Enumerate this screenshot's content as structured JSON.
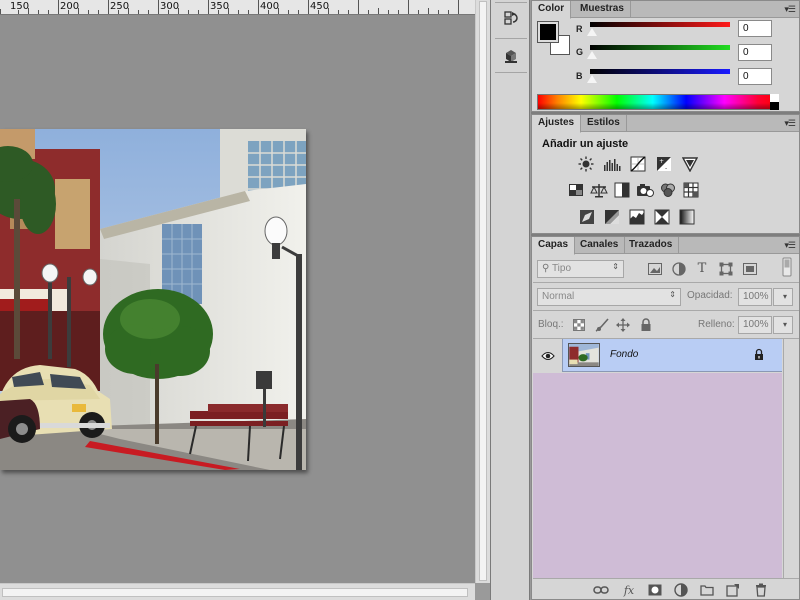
{
  "ruler": {
    "labels": [
      "150",
      "200",
      "250",
      "300",
      "350",
      "400",
      "450"
    ]
  },
  "color_panel": {
    "tabs": [
      "Color",
      "Muestras"
    ],
    "channels": [
      {
        "label": "R",
        "value": "0",
        "gradient_end": "#ff1a1a"
      },
      {
        "label": "G",
        "value": "0",
        "gradient_end": "#22dd22"
      },
      {
        "label": "B",
        "value": "0",
        "gradient_end": "#1a1aff"
      }
    ],
    "foreground_color": "#000000",
    "background_color": "#ffffff"
  },
  "adjustments_panel": {
    "tabs": [
      "Ajustes",
      "Estilos"
    ],
    "title": "Añadir un ajuste",
    "rows": [
      [
        "brightness-contrast-icon",
        "levels-icon",
        "curves-icon",
        "exposure-icon",
        "vibrance-icon"
      ],
      [
        "hue-saturation-icon",
        "color-balance-icon",
        "black-white-icon",
        "photo-filter-icon",
        "channel-mixer-icon",
        "color-lookup-icon"
      ],
      [
        "invert-icon",
        "posterize-icon",
        "threshold-icon",
        "selective-color-icon",
        "gradient-map-icon"
      ]
    ]
  },
  "layers_panel": {
    "tabs": [
      "Capas",
      "Canales",
      "Trazados"
    ],
    "filter_kind": "Tipo",
    "blend_mode": "Normal",
    "opacity_label": "Opacidad:",
    "opacity_value": "100%",
    "lock_label": "Bloq.:",
    "fill_label": "Relleno:",
    "fill_value": "100%",
    "layers": [
      {
        "name": "Fondo",
        "visible": true,
        "locked": true
      }
    ],
    "list_background": "#cfbcd6",
    "selected_row_color": "#b9cdf4"
  }
}
